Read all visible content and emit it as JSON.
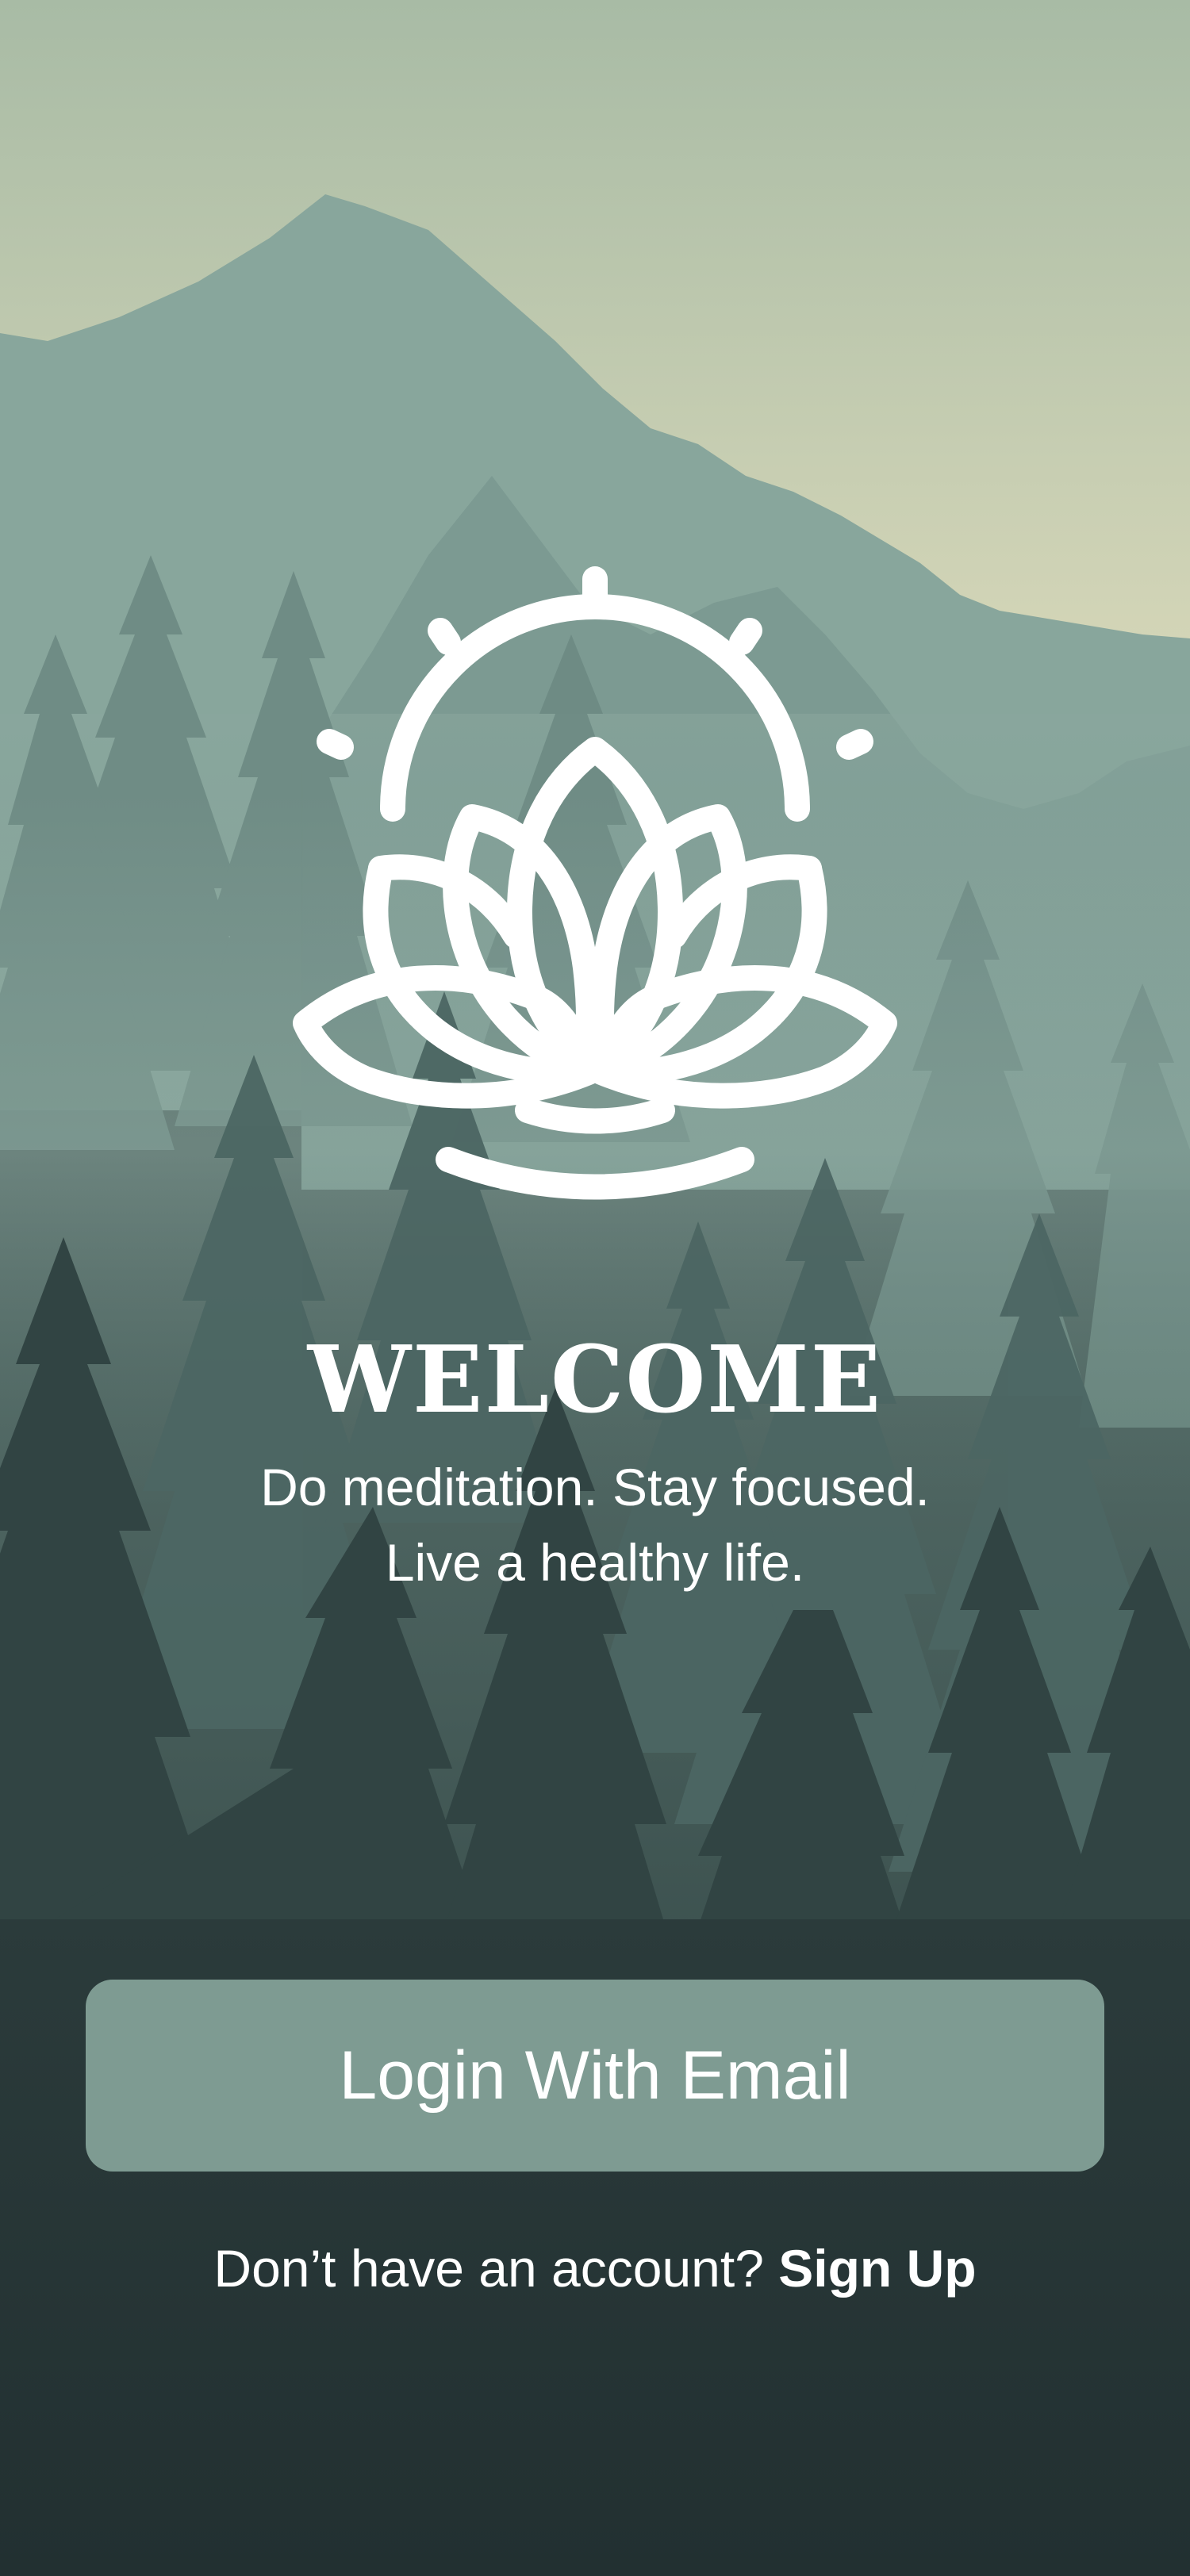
{
  "welcome": {
    "title": "WELCOME",
    "subtitle_line1": "Do meditation. Stay focused.",
    "subtitle_line2": "Live a healthy life."
  },
  "logo": {
    "icon": "lotus-icon"
  },
  "actions": {
    "login_label": "Login With Email",
    "signup_prompt": "Don’t have an account?",
    "signup_label": "Sign Up"
  },
  "colors": {
    "sky_top": "#a9bba5",
    "sky_bottom": "#d6d7b8",
    "mountain_far": "#89a99e",
    "forest_dark": "#243132",
    "button": "#7e9b92",
    "text": "#ffffff"
  }
}
